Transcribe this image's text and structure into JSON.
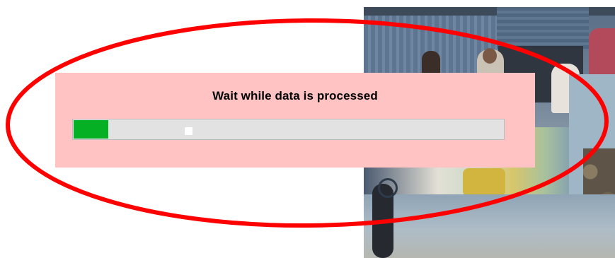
{
  "dialog": {
    "message": "Wait while data is processed",
    "progress": 0.08
  },
  "colors": {
    "progress_fill": "#06b025",
    "dialog_background": "#ffc3c3",
    "progress_track": "#e2e2e2",
    "highlight": "#ff0000"
  },
  "icons": {
    "progress_spark": "white-square-glint"
  }
}
